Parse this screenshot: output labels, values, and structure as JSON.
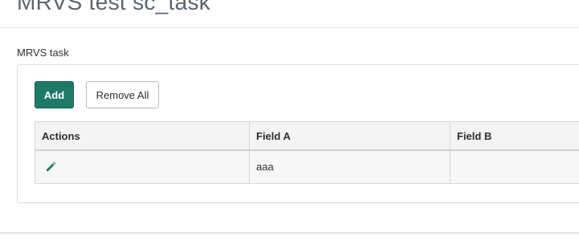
{
  "page": {
    "title": "MRVS test sc_task"
  },
  "variable_set": {
    "label": "MRVS task",
    "add_label": "Add",
    "remove_all_label": "Remove All",
    "columns": [
      "Actions",
      "Field A",
      "Field B"
    ],
    "rows": [
      {
        "actions_icon": "pencil-edit-icon",
        "field_a": "aaa",
        "field_b": ""
      }
    ]
  },
  "colors": {
    "primary": "#1d7a67",
    "icon": "#1d7a67"
  }
}
